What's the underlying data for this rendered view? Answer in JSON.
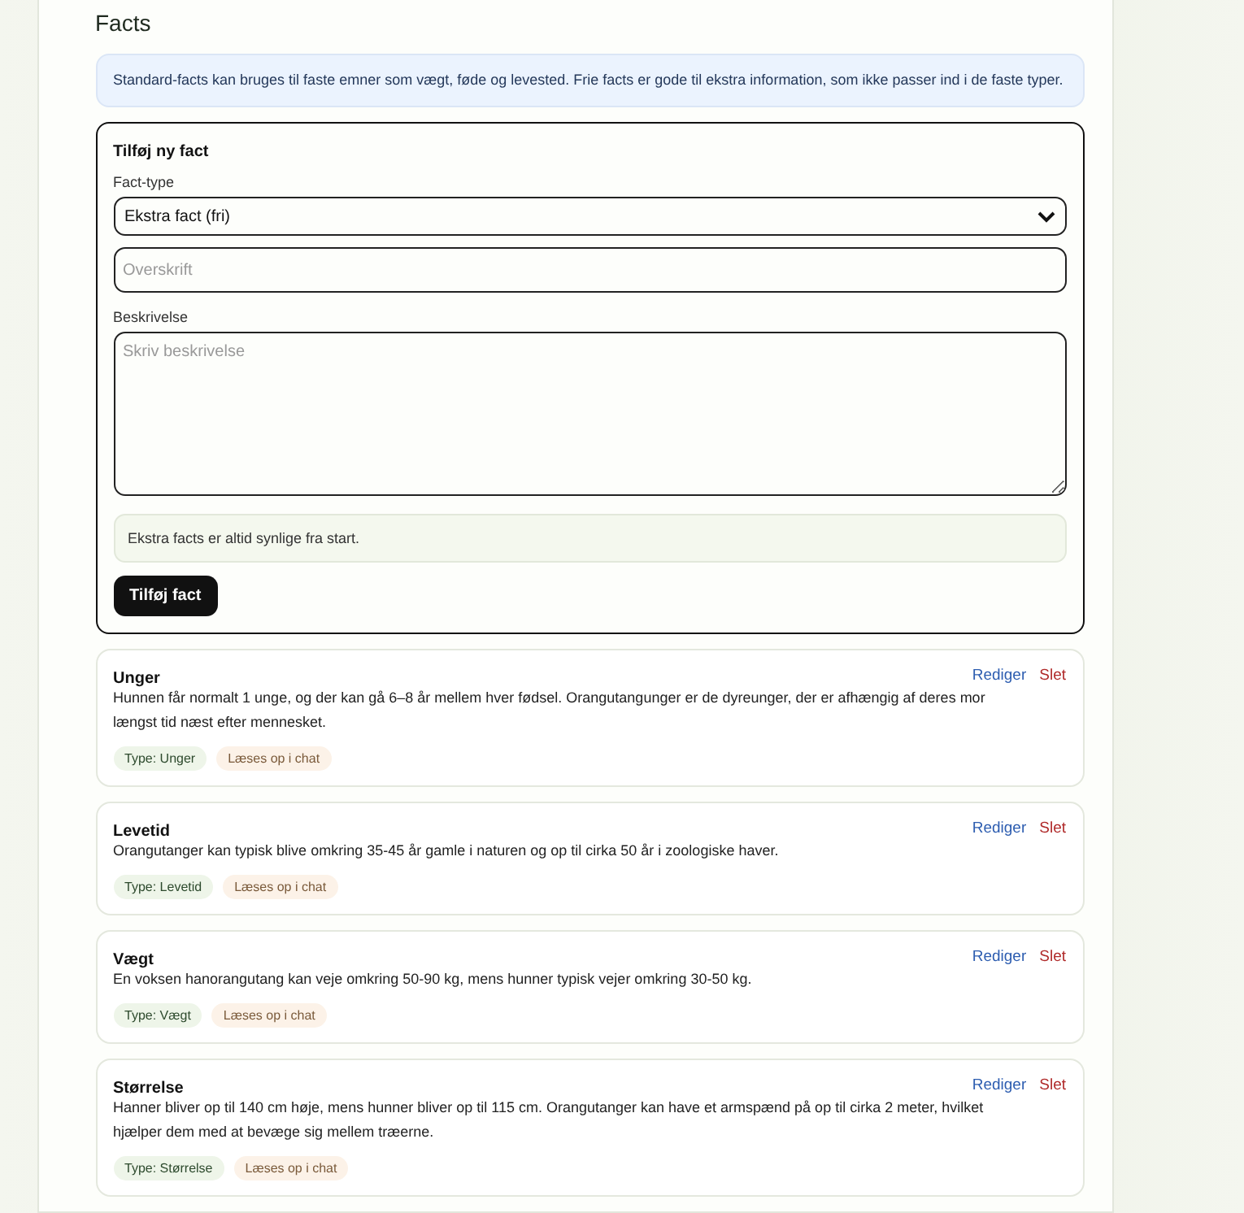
{
  "section_title": "Facts",
  "info": "Standard-facts kan bruges til faste emner som vægt, føde og levested. Frie facts er gode til ekstra information, som ikke passer ind i de faste typer.",
  "form": {
    "title": "Tilføj ny fact",
    "type_label": "Fact-type",
    "type_value": "Ekstra fact (fri)",
    "heading_placeholder": "Overskrift",
    "description_label": "Beskrivelse",
    "description_placeholder": "Skriv beskrivelse",
    "hint": "Ekstra facts er altid synlige fra start.",
    "submit": "Tilføj fact"
  },
  "facts": [
    {
      "title": "Unger",
      "text": "Hunnen får normalt 1 unge, og der kan gå 6–8 år mellem hver fødsel. Orangutangunger er de dyreunger, der er afhængig af deres mor længst tid næst efter mennesket.",
      "type_tag": "Type: Unger",
      "chat_tag": "Læses op i chat",
      "edit": "Rediger",
      "delete": "Slet"
    },
    {
      "title": "Levetid",
      "text": "Orangutanger kan typisk blive omkring 35-45 år gamle i naturen og op til cirka 50 år i zoologiske haver.",
      "type_tag": "Type: Levetid",
      "chat_tag": "Læses op i chat",
      "edit": "Rediger",
      "delete": "Slet"
    },
    {
      "title": "Vægt",
      "text": "En voksen hanorangutang kan veje omkring 50-90 kg, mens hunner typisk vejer omkring 30-50 kg.",
      "type_tag": "Type: Vægt",
      "chat_tag": "Læses op i chat",
      "edit": "Rediger",
      "delete": "Slet"
    },
    {
      "title": "Størrelse",
      "text": "Hanner bliver op til 140 cm høje, mens hunner bliver op til 115 cm. Orangutanger kan have et armspænd på op til cirka 2 meter, hvilket hjælper dem med at bevæge sig mellem træerne.",
      "type_tag": "Type: Størrelse",
      "chat_tag": "Læses op i chat",
      "edit": "Rediger",
      "delete": "Slet"
    }
  ]
}
